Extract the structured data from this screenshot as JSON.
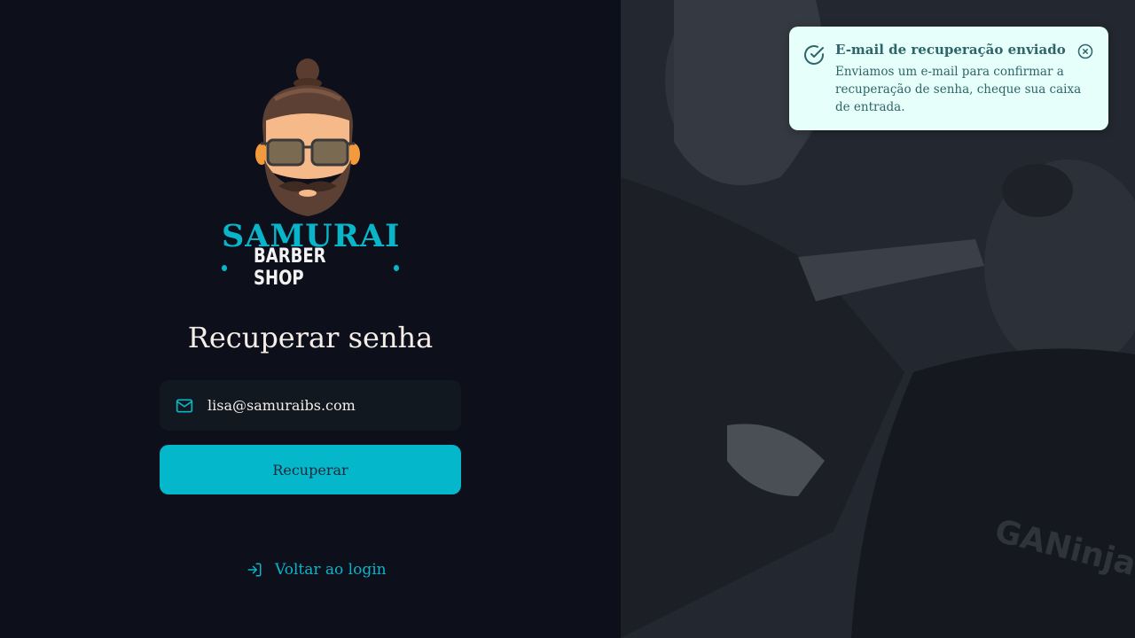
{
  "logo": {
    "brand": "SAMURAI",
    "subtitle": "BARBER SHOP",
    "icon": "bearded-barber-mascot"
  },
  "form": {
    "title": "Recuperar senha",
    "email_value": "lisa@samuraibs.com",
    "email_icon": "mail-icon",
    "submit_label": "Recuperar"
  },
  "back_link": {
    "label": "Voltar ao login",
    "icon": "log-in-icon"
  },
  "toast": {
    "title": "E-mail de recuperação enviado",
    "message": "Enviamos um e-mail para confirmar a recuperação de senha, cheque sua caixa de entrada.",
    "icon": "check-circle-icon",
    "close_icon": "x-circle-icon"
  },
  "background": {
    "image_text": "GANinja"
  },
  "colors": {
    "accent": "#05b7cb",
    "background": "#0d0f1a",
    "input_bg": "#111820",
    "text": "#f4ede8",
    "toast_bg": "#e6fffa",
    "toast_text": "#2e656a"
  }
}
